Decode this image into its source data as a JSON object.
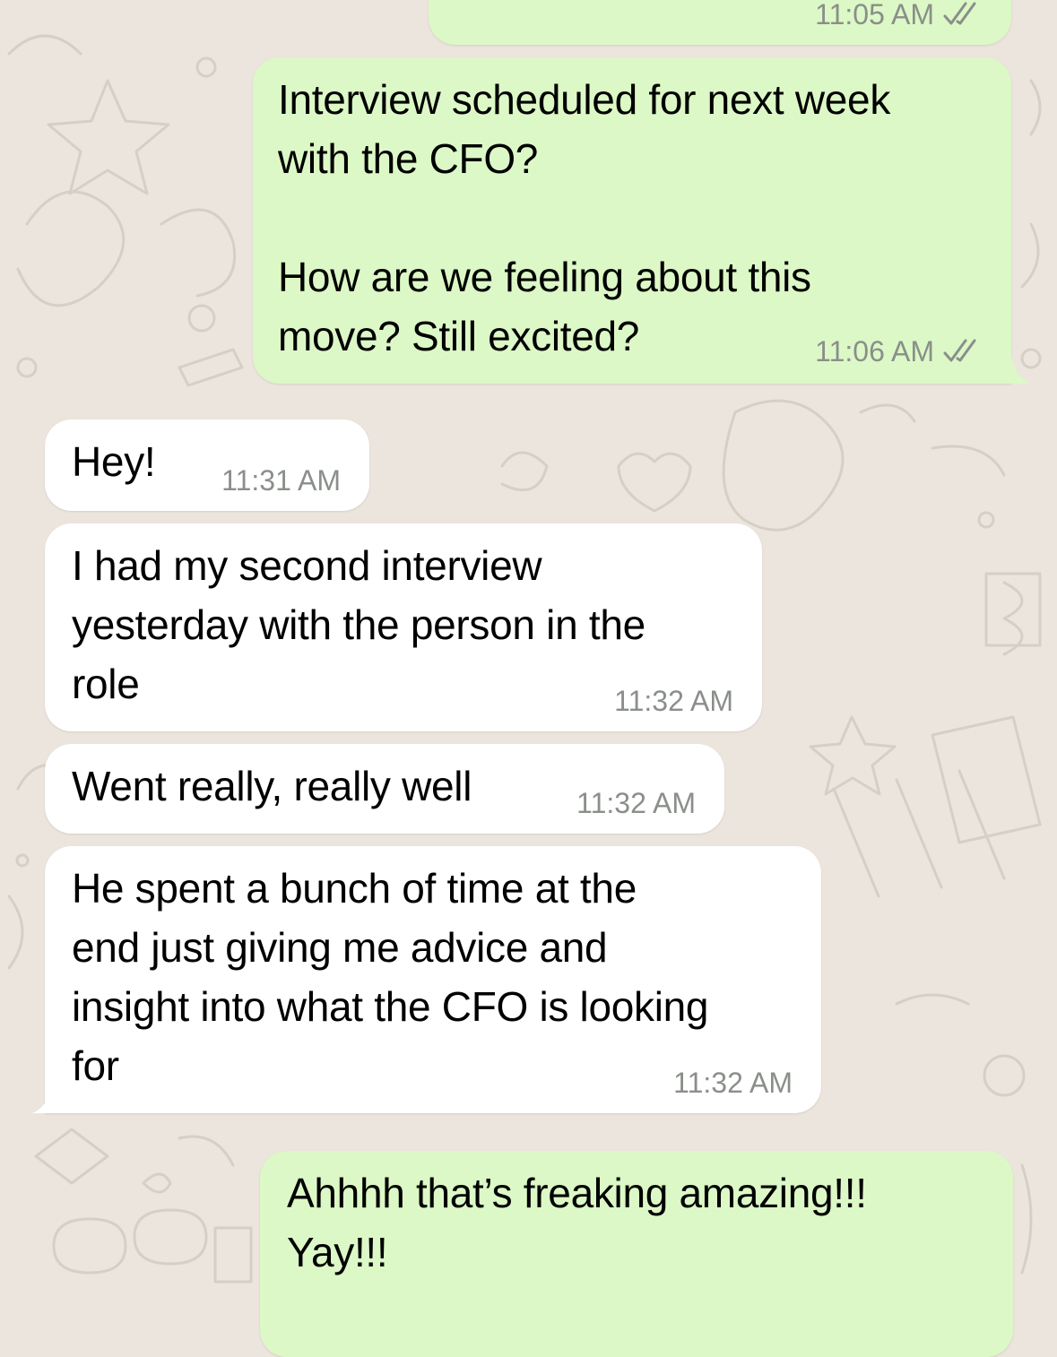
{
  "colors": {
    "outgoing_bubble": "#DCF8C6",
    "incoming_bubble": "#FFFFFF",
    "wallpaper": "#ECE5DD",
    "timestamp": "#8a8f8a"
  },
  "messages": [
    {
      "direction": "outgoing",
      "text": "",
      "time": "11:05 AM",
      "status_icon": "double-check-icon"
    },
    {
      "direction": "outgoing",
      "text": "Interview scheduled for next week\nwith the CFO?\n\nHow are we feeling about this\nmove?  Still excited?",
      "time": "11:06 AM",
      "status_icon": "double-check-icon"
    },
    {
      "direction": "incoming",
      "text": "Hey!",
      "time": "11:31 AM"
    },
    {
      "direction": "incoming",
      "text": "I had my second interview\nyesterday with the person in the\nrole",
      "time": "11:32 AM"
    },
    {
      "direction": "incoming",
      "text": "Went really, really well",
      "time": "11:32 AM"
    },
    {
      "direction": "incoming",
      "text": "He spent a bunch of time at the\nend just giving me advice and\ninsight into what the CFO is looking\nfor",
      "time": "11:32 AM"
    },
    {
      "direction": "outgoing",
      "text": "Ahhhh that’s freaking amazing!!!\nYay!!!",
      "time": ""
    }
  ]
}
